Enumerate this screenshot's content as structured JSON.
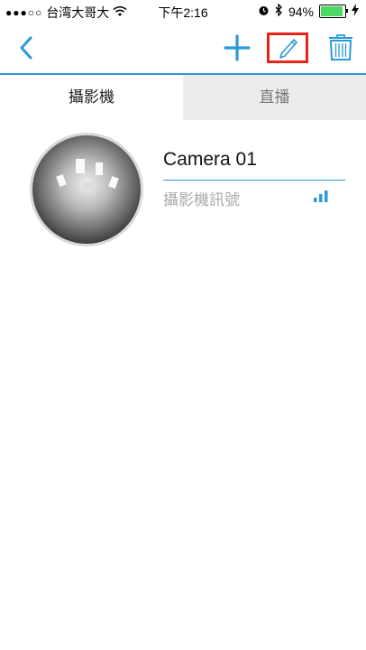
{
  "status_bar": {
    "carrier": "台湾大哥大",
    "time": "下午2:16",
    "battery_percent": "94%",
    "battery_level": 0.94,
    "signal_dots": "●●●○○",
    "icons": [
      "wifi-icon",
      "alarm-icon",
      "bluetooth-icon",
      "battery-icon",
      "charging-icon"
    ]
  },
  "nav": {
    "icons": [
      "back-chevron-icon",
      "add-icon",
      "pencil-edit-icon",
      "trash-icon"
    ],
    "accent_color": "#2a9ad8",
    "highlight_color": "#e8231a"
  },
  "tabs": [
    {
      "label": "攝影機",
      "selected": true
    },
    {
      "label": "直播",
      "selected": false
    }
  ],
  "cameras": [
    {
      "name": "Camera 01",
      "signal_label": "攝影機訊號",
      "thumbnail_icon": "fisheye-camera-thumbnail"
    }
  ]
}
